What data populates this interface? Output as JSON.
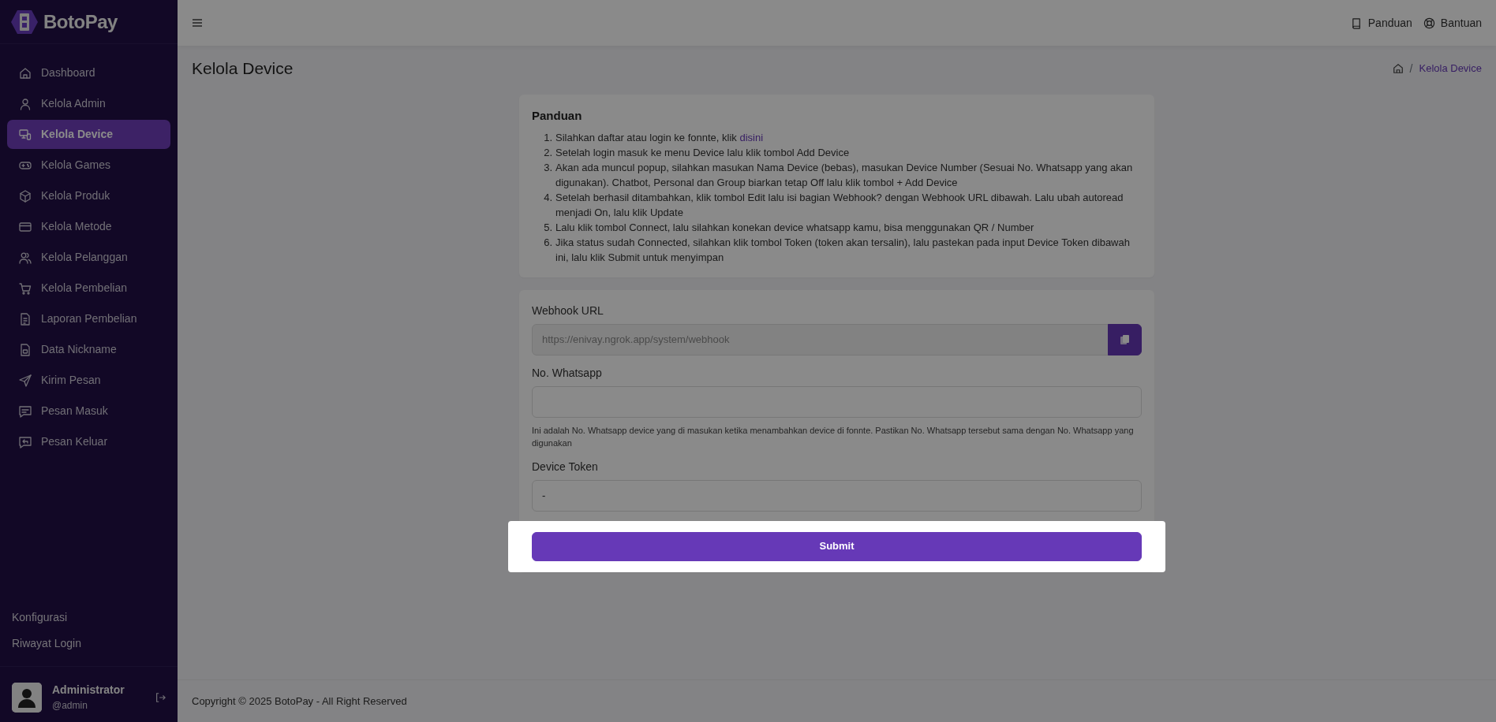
{
  "brand": {
    "name": "BotoPay"
  },
  "sidebar": {
    "items": [
      {
        "label": "Dashboard",
        "selected": false
      },
      {
        "label": "Kelola Admin",
        "selected": false
      },
      {
        "label": "Kelola Device",
        "selected": true
      },
      {
        "label": "Kelola Games",
        "selected": false
      },
      {
        "label": "Kelola Produk",
        "selected": false
      },
      {
        "label": "Kelola Metode",
        "selected": false
      },
      {
        "label": "Kelola Pelanggan",
        "selected": false
      },
      {
        "label": "Kelola Pembelian",
        "selected": false
      },
      {
        "label": "Laporan Pembelian",
        "selected": false
      },
      {
        "label": "Data Nickname",
        "selected": false
      },
      {
        "label": "Kirim Pesan",
        "selected": false
      },
      {
        "label": "Pesan Masuk",
        "selected": false
      },
      {
        "label": "Pesan Keluar",
        "selected": false
      }
    ],
    "bottom_links": [
      "Konfigurasi",
      "Riwayat Login"
    ],
    "user": {
      "name": "Administrator",
      "handle": "@admin"
    }
  },
  "topbar": {
    "links": [
      "Panduan",
      "Bantuan"
    ]
  },
  "page": {
    "title": "Kelola Device",
    "breadcrumb": {
      "separator": "/",
      "items": [
        "Kelola Device"
      ]
    }
  },
  "guide": {
    "title": "Panduan",
    "steps": [
      {
        "number": "1.",
        "text": "Silahkan daftar atau login ke fonnte, klik ",
        "link": "disini"
      },
      {
        "number": "2.",
        "text": "Setelah login masuk ke menu Device lalu klik tombol Add Device"
      },
      {
        "number": "3.",
        "text": "Akan ada muncul popup, silahkan masukan Nama Device (bebas), masukan Device Number (Sesuai No. Whatsapp yang akan digunakan). Chatbot, Personal dan Group biarkan tetap Off lalu klik tombol + Add Device"
      },
      {
        "number": "4.",
        "text": "Setelah berhasil ditambahkan, klik tombol Edit lalu isi bagian Webhook? dengan Webhook URL dibawah. Lalu ubah autoread menjadi On, lalu klik Update"
      },
      {
        "number": "5.",
        "text": "Lalu klik tombol Connect, lalu silahkan konekan device whatsapp kamu, bisa menggunakan QR / Number"
      },
      {
        "number": "6.",
        "text": "Jika status sudah Connected, silahkan klik tombol Token (token akan tersalin), lalu pastekan pada input Device Token dibawah ini, lalu klik Submit untuk menyimpan"
      }
    ]
  },
  "form": {
    "fields": [
      {
        "kind": "copy",
        "label": "Webhook URL",
        "value": "https://enivay.ngrok.app/system/webhook",
        "disabled": true
      },
      {
        "kind": "text",
        "label": "No. Whatsapp",
        "help": "Ini adalah No. Whatsapp device yang di masukan ketika menambahkan device di fonnte. Pastikan No. Whatsapp tersebut sama dengan No. Whatsapp yang digunakan",
        "disabled": false
      },
      {
        "kind": "text",
        "label": "Device Token",
        "value": "-",
        "disabled": false
      }
    ],
    "submit": {
      "label": "Submit",
      "spotlight": true
    }
  },
  "footer": {
    "text": "Copyright © 2025 BotoPay - All Right Reserved"
  }
}
